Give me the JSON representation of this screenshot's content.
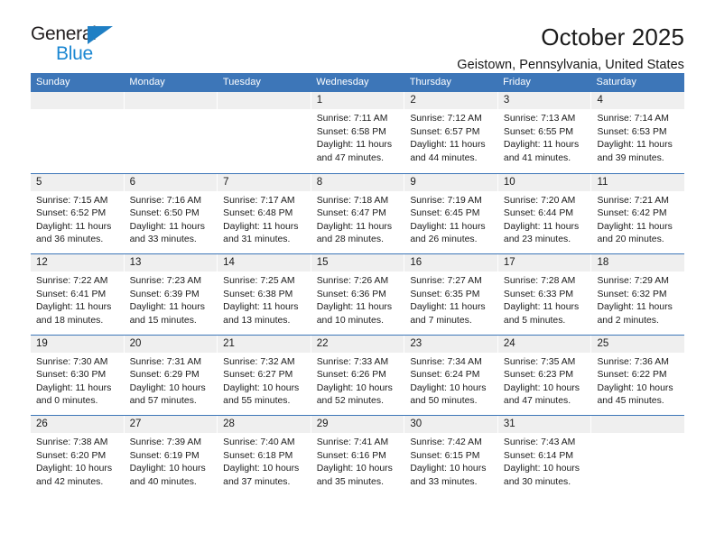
{
  "logo": {
    "word_one": "General",
    "word_two": "Blue",
    "triangle_color": "#1f7fc4",
    "word_two_color": "#1b87d2"
  },
  "header": {
    "title": "October 2025",
    "subtitle": "Geistown, Pennsylvania, United States"
  },
  "theme": {
    "header_blue": "#3d76b8",
    "day_band_gray": "#efefef",
    "text": "#1a1a1a"
  },
  "calendar": {
    "weekday_headers": [
      "Sunday",
      "Monday",
      "Tuesday",
      "Wednesday",
      "Thursday",
      "Friday",
      "Saturday"
    ],
    "weeks": [
      [
        {
          "day": "",
          "empty": true
        },
        {
          "day": "",
          "empty": true
        },
        {
          "day": "",
          "empty": true
        },
        {
          "day": "1",
          "sunrise": "Sunrise: 7:11 AM",
          "sunset": "Sunset: 6:58 PM",
          "daylight1": "Daylight: 11 hours",
          "daylight2": "and 47 minutes."
        },
        {
          "day": "2",
          "sunrise": "Sunrise: 7:12 AM",
          "sunset": "Sunset: 6:57 PM",
          "daylight1": "Daylight: 11 hours",
          "daylight2": "and 44 minutes."
        },
        {
          "day": "3",
          "sunrise": "Sunrise: 7:13 AM",
          "sunset": "Sunset: 6:55 PM",
          "daylight1": "Daylight: 11 hours",
          "daylight2": "and 41 minutes."
        },
        {
          "day": "4",
          "sunrise": "Sunrise: 7:14 AM",
          "sunset": "Sunset: 6:53 PM",
          "daylight1": "Daylight: 11 hours",
          "daylight2": "and 39 minutes."
        }
      ],
      [
        {
          "day": "5",
          "sunrise": "Sunrise: 7:15 AM",
          "sunset": "Sunset: 6:52 PM",
          "daylight1": "Daylight: 11 hours",
          "daylight2": "and 36 minutes."
        },
        {
          "day": "6",
          "sunrise": "Sunrise: 7:16 AM",
          "sunset": "Sunset: 6:50 PM",
          "daylight1": "Daylight: 11 hours",
          "daylight2": "and 33 minutes."
        },
        {
          "day": "7",
          "sunrise": "Sunrise: 7:17 AM",
          "sunset": "Sunset: 6:48 PM",
          "daylight1": "Daylight: 11 hours",
          "daylight2": "and 31 minutes."
        },
        {
          "day": "8",
          "sunrise": "Sunrise: 7:18 AM",
          "sunset": "Sunset: 6:47 PM",
          "daylight1": "Daylight: 11 hours",
          "daylight2": "and 28 minutes."
        },
        {
          "day": "9",
          "sunrise": "Sunrise: 7:19 AM",
          "sunset": "Sunset: 6:45 PM",
          "daylight1": "Daylight: 11 hours",
          "daylight2": "and 26 minutes."
        },
        {
          "day": "10",
          "sunrise": "Sunrise: 7:20 AM",
          "sunset": "Sunset: 6:44 PM",
          "daylight1": "Daylight: 11 hours",
          "daylight2": "and 23 minutes."
        },
        {
          "day": "11",
          "sunrise": "Sunrise: 7:21 AM",
          "sunset": "Sunset: 6:42 PM",
          "daylight1": "Daylight: 11 hours",
          "daylight2": "and 20 minutes."
        }
      ],
      [
        {
          "day": "12",
          "sunrise": "Sunrise: 7:22 AM",
          "sunset": "Sunset: 6:41 PM",
          "daylight1": "Daylight: 11 hours",
          "daylight2": "and 18 minutes."
        },
        {
          "day": "13",
          "sunrise": "Sunrise: 7:23 AM",
          "sunset": "Sunset: 6:39 PM",
          "daylight1": "Daylight: 11 hours",
          "daylight2": "and 15 minutes."
        },
        {
          "day": "14",
          "sunrise": "Sunrise: 7:25 AM",
          "sunset": "Sunset: 6:38 PM",
          "daylight1": "Daylight: 11 hours",
          "daylight2": "and 13 minutes."
        },
        {
          "day": "15",
          "sunrise": "Sunrise: 7:26 AM",
          "sunset": "Sunset: 6:36 PM",
          "daylight1": "Daylight: 11 hours",
          "daylight2": "and 10 minutes."
        },
        {
          "day": "16",
          "sunrise": "Sunrise: 7:27 AM",
          "sunset": "Sunset: 6:35 PM",
          "daylight1": "Daylight: 11 hours",
          "daylight2": "and 7 minutes."
        },
        {
          "day": "17",
          "sunrise": "Sunrise: 7:28 AM",
          "sunset": "Sunset: 6:33 PM",
          "daylight1": "Daylight: 11 hours",
          "daylight2": "and 5 minutes."
        },
        {
          "day": "18",
          "sunrise": "Sunrise: 7:29 AM",
          "sunset": "Sunset: 6:32 PM",
          "daylight1": "Daylight: 11 hours",
          "daylight2": "and 2 minutes."
        }
      ],
      [
        {
          "day": "19",
          "sunrise": "Sunrise: 7:30 AM",
          "sunset": "Sunset: 6:30 PM",
          "daylight1": "Daylight: 11 hours",
          "daylight2": "and 0 minutes."
        },
        {
          "day": "20",
          "sunrise": "Sunrise: 7:31 AM",
          "sunset": "Sunset: 6:29 PM",
          "daylight1": "Daylight: 10 hours",
          "daylight2": "and 57 minutes."
        },
        {
          "day": "21",
          "sunrise": "Sunrise: 7:32 AM",
          "sunset": "Sunset: 6:27 PM",
          "daylight1": "Daylight: 10 hours",
          "daylight2": "and 55 minutes."
        },
        {
          "day": "22",
          "sunrise": "Sunrise: 7:33 AM",
          "sunset": "Sunset: 6:26 PM",
          "daylight1": "Daylight: 10 hours",
          "daylight2": "and 52 minutes."
        },
        {
          "day": "23",
          "sunrise": "Sunrise: 7:34 AM",
          "sunset": "Sunset: 6:24 PM",
          "daylight1": "Daylight: 10 hours",
          "daylight2": "and 50 minutes."
        },
        {
          "day": "24",
          "sunrise": "Sunrise: 7:35 AM",
          "sunset": "Sunset: 6:23 PM",
          "daylight1": "Daylight: 10 hours",
          "daylight2": "and 47 minutes."
        },
        {
          "day": "25",
          "sunrise": "Sunrise: 7:36 AM",
          "sunset": "Sunset: 6:22 PM",
          "daylight1": "Daylight: 10 hours",
          "daylight2": "and 45 minutes."
        }
      ],
      [
        {
          "day": "26",
          "sunrise": "Sunrise: 7:38 AM",
          "sunset": "Sunset: 6:20 PM",
          "daylight1": "Daylight: 10 hours",
          "daylight2": "and 42 minutes."
        },
        {
          "day": "27",
          "sunrise": "Sunrise: 7:39 AM",
          "sunset": "Sunset: 6:19 PM",
          "daylight1": "Daylight: 10 hours",
          "daylight2": "and 40 minutes."
        },
        {
          "day": "28",
          "sunrise": "Sunrise: 7:40 AM",
          "sunset": "Sunset: 6:18 PM",
          "daylight1": "Daylight: 10 hours",
          "daylight2": "and 37 minutes."
        },
        {
          "day": "29",
          "sunrise": "Sunrise: 7:41 AM",
          "sunset": "Sunset: 6:16 PM",
          "daylight1": "Daylight: 10 hours",
          "daylight2": "and 35 minutes."
        },
        {
          "day": "30",
          "sunrise": "Sunrise: 7:42 AM",
          "sunset": "Sunset: 6:15 PM",
          "daylight1": "Daylight: 10 hours",
          "daylight2": "and 33 minutes."
        },
        {
          "day": "31",
          "sunrise": "Sunrise: 7:43 AM",
          "sunset": "Sunset: 6:14 PM",
          "daylight1": "Daylight: 10 hours",
          "daylight2": "and 30 minutes."
        },
        {
          "day": "",
          "empty": true
        }
      ]
    ]
  }
}
